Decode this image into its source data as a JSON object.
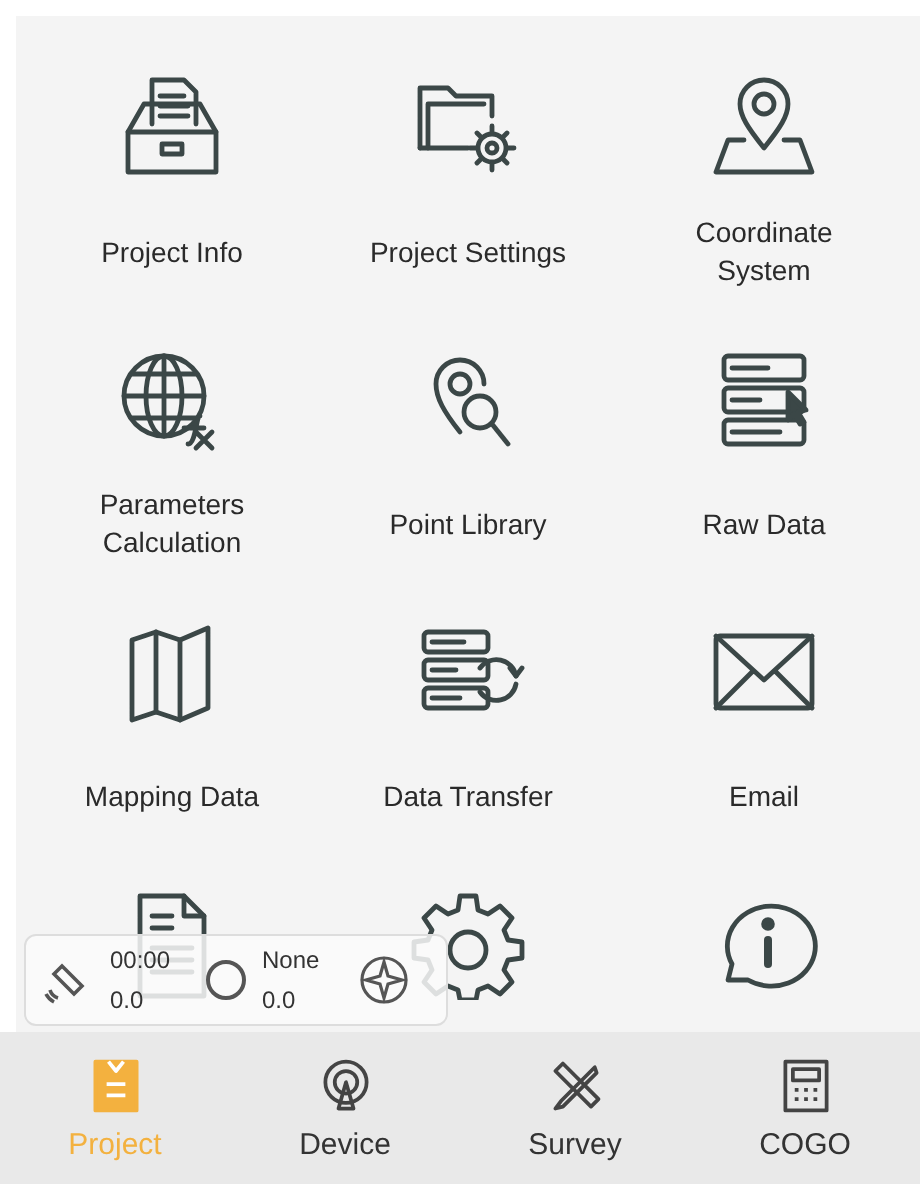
{
  "items": [
    {
      "label": "Project Info"
    },
    {
      "label": "Project Settings"
    },
    {
      "label": "Coordinate System"
    },
    {
      "label": "Parameters Calculation"
    },
    {
      "label": "Point Library"
    },
    {
      "label": "Raw Data"
    },
    {
      "label": "Mapping Data"
    },
    {
      "label": "Data Transfer"
    },
    {
      "label": "Email"
    }
  ],
  "status_widget": {
    "time": "00:00",
    "value_1": "0.0",
    "solution": "None",
    "value_2": "0.0"
  },
  "tabs": [
    {
      "label": "Project",
      "selected": true
    },
    {
      "label": "Device",
      "selected": false
    },
    {
      "label": "Survey",
      "selected": false
    },
    {
      "label": "COGO",
      "selected": false
    }
  ]
}
